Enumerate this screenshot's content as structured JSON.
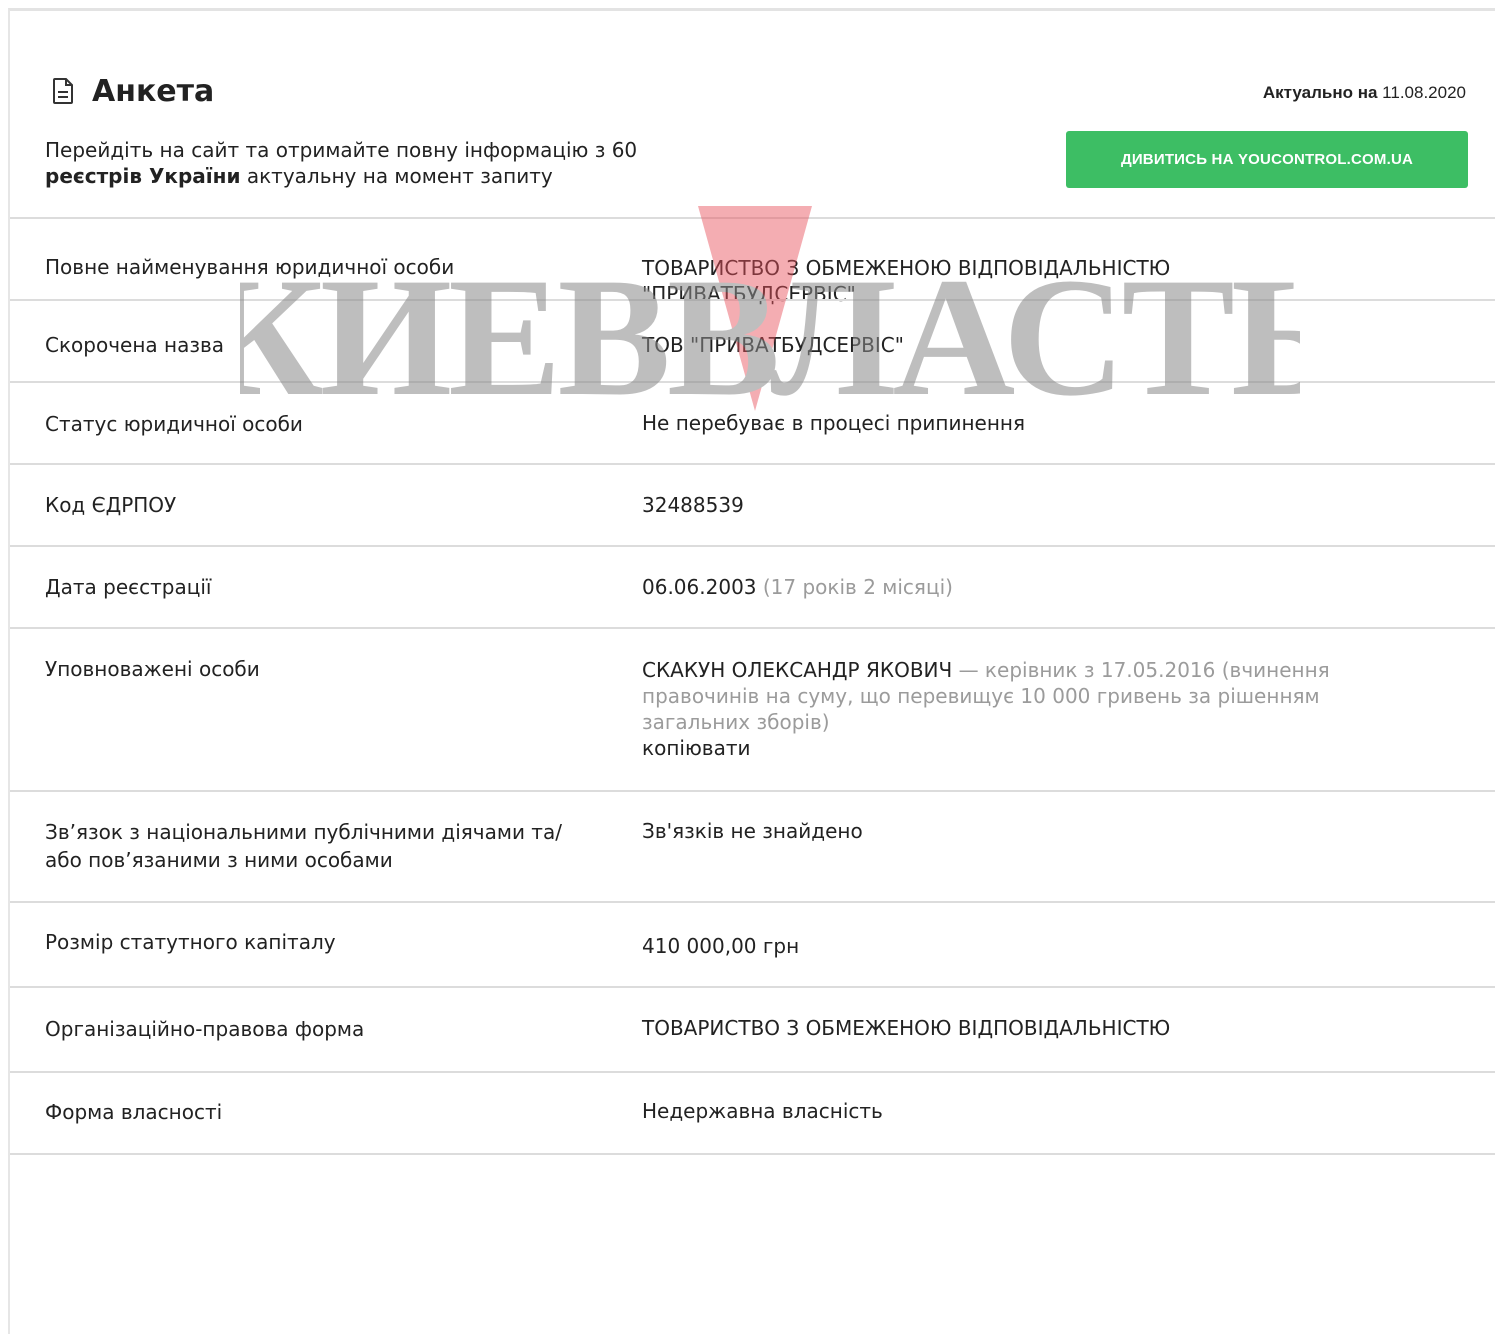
{
  "header": {
    "title": "Анкета",
    "actual_label": "Актуально на",
    "actual_date": "11.08.2020",
    "promo_part1": "Перейдіть на сайт та отримайте повну інформацію з 60 ",
    "promo_bold": "реєстрів України",
    "promo_part2": " актуальну на момент запиту",
    "cta_label": "ДИВИТИСЬ НА YOUCONTROL.COM.UA"
  },
  "watermark_text": "КИЕВВЛАСТЬ",
  "rows": {
    "full_name": {
      "label": "Повне найменування юридичної особи",
      "value": "ТОВАРИСТВО З ОБМЕЖЕНОЮ ВІДПОВІДАЛЬНІСТЮ \"ПРИВАТБУДСЕРВІС\""
    },
    "short_name": {
      "label": "Скорочена назва",
      "value": "ТОВ \"ПРИВАТБУДСЕРВІС\""
    },
    "status": {
      "label": "Статус юридичної особи",
      "value": "Не перебуває в процесі припинення"
    },
    "edrpou": {
      "label": "Код ЄДРПОУ",
      "value": "32488539"
    },
    "reg_date": {
      "label": "Дата реєстрації",
      "value": "06.06.2003",
      "note": "(17 років 2 місяці)"
    },
    "authorized": {
      "label": "Уповноважені особи",
      "person": "СКАКУН ОЛЕКСАНДР ЯКОВИЧ",
      "note": " — керівник з 17.05.2016 (вчинення правочинів на суму, що перевищує 10 000 гривень за рішенням загальних зборів)",
      "copy_label": "копіювати"
    },
    "pep": {
      "label": "Зв’язок з національними публічними діячами та/або пов’язаними з ними особами",
      "value": "Зв'язків не знайдено"
    },
    "capital": {
      "label": "Розмір статутного капіталу",
      "value": "410 000,00 грн"
    },
    "legal_form": {
      "label": "Організаційно-правова форма",
      "value": "ТОВАРИСТВО З ОБМЕЖЕНОЮ ВІДПОВІДАЛЬНІСТЮ"
    },
    "ownership": {
      "label": "Форма власності",
      "value": "Недержавна власність"
    }
  },
  "colors": {
    "accent": "#3dbe64",
    "muted": "#9b9b9b",
    "watermark_red": "#e8505b",
    "watermark_gray": "#8a8a8a"
  }
}
